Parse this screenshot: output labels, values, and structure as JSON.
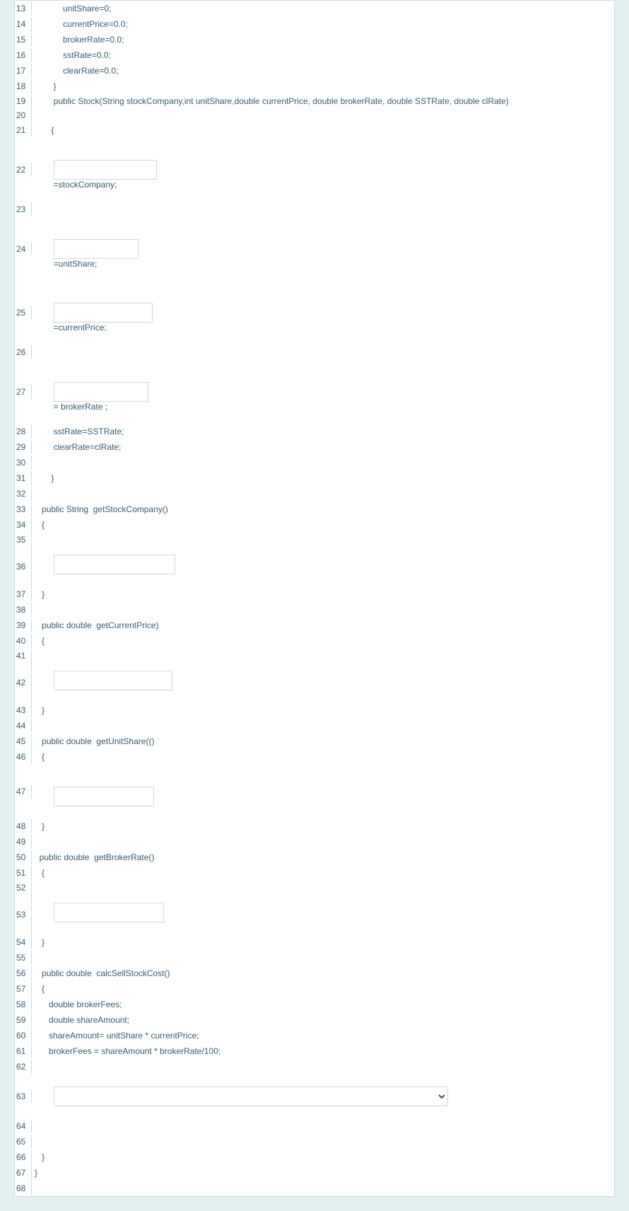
{
  "lines": {
    "l13": {
      "num": "13",
      "text": "            unitShare=0;"
    },
    "l14": {
      "num": "14",
      "text": "            currentPrice=0.0;"
    },
    "l15": {
      "num": "15",
      "text": "            brokerRate=0.0;"
    },
    "l16": {
      "num": "16",
      "text": "            sstRate=0.0;"
    },
    "l17": {
      "num": "17",
      "text": "            clearRate=0.0;"
    },
    "l18": {
      "num": "18",
      "text": "        }"
    },
    "l19": {
      "num": "19",
      "text": "        public Stock(String stockCompany,int unitShare,double currentPrice, double brokerRate, double SSTRate, double clRate)"
    },
    "l20": {
      "num": "20"
    },
    "l21": {
      "num": "21",
      "text": "       {"
    },
    "l22": {
      "num": "22",
      "after": "=stockCompany;"
    },
    "l23": {
      "num": "23"
    },
    "l24": {
      "num": "24",
      "after": "=unitShare;"
    },
    "l25": {
      "num": "25",
      "after": "=currentPrice;"
    },
    "l26": {
      "num": "26"
    },
    "l27": {
      "num": "27",
      "after": "= brokerRate ;"
    },
    "l28": {
      "num": "28",
      "text": "        sstRate=SSTRate;"
    },
    "l29": {
      "num": "29",
      "text": "        clearRate=clRate;"
    },
    "l30": {
      "num": "30",
      "text": ""
    },
    "l31": {
      "num": "31",
      "text": "       }"
    },
    "l32": {
      "num": "32",
      "text": ""
    },
    "l33": {
      "num": "33",
      "text": "   public String  getStockCompany()"
    },
    "l34": {
      "num": "34",
      "text": "   {"
    },
    "l35": {
      "num": "35"
    },
    "l36": {
      "num": "36"
    },
    "l37": {
      "num": "37",
      "text": "   }"
    },
    "l38": {
      "num": "38",
      "text": ""
    },
    "l39": {
      "num": "39",
      "text": "   public double  getCurrentPrice)"
    },
    "l40": {
      "num": "40",
      "text": "   {"
    },
    "l41": {
      "num": "41"
    },
    "l42": {
      "num": "42"
    },
    "l43": {
      "num": "43",
      "text": "   }"
    },
    "l44": {
      "num": "44",
      "text": ""
    },
    "l45": {
      "num": "45",
      "text": "   public double  getUnitShare(()"
    },
    "l46": {
      "num": "46",
      "text": "   {"
    },
    "l47": {
      "num": "47"
    },
    "l48": {
      "num": "48",
      "text": "   }"
    },
    "l49": {
      "num": "49",
      "text": ""
    },
    "l50": {
      "num": "50",
      "text": "  public double  getBrokerRate()"
    },
    "l51": {
      "num": "51",
      "text": "   {"
    },
    "l52": {
      "num": "52"
    },
    "l53": {
      "num": "53"
    },
    "l54": {
      "num": "54",
      "text": "   }"
    },
    "l55": {
      "num": "55",
      "text": ""
    },
    "l56": {
      "num": "56",
      "text": "   public double  calcSellStockCost()"
    },
    "l57": {
      "num": "57",
      "text": "   {"
    },
    "l58": {
      "num": "58",
      "text": "      double brokerFees;"
    },
    "l59": {
      "num": "59",
      "text": "      double shareAmount;"
    },
    "l60": {
      "num": "60",
      "text": "      shareAmount= unitShare * currentPrice;"
    },
    "l61": {
      "num": "61",
      "text": "      brokerFees = shareAmount * brokerRate/100;"
    },
    "l62": {
      "num": "62",
      "text": ""
    },
    "l63": {
      "num": "63"
    },
    "l64": {
      "num": "64",
      "text": ""
    },
    "l65": {
      "num": "65",
      "text": ""
    },
    "l66": {
      "num": "66",
      "text": "   }"
    },
    "l67": {
      "num": "67",
      "text": "}"
    },
    "l68": {
      "num": "68",
      "text": ""
    }
  }
}
